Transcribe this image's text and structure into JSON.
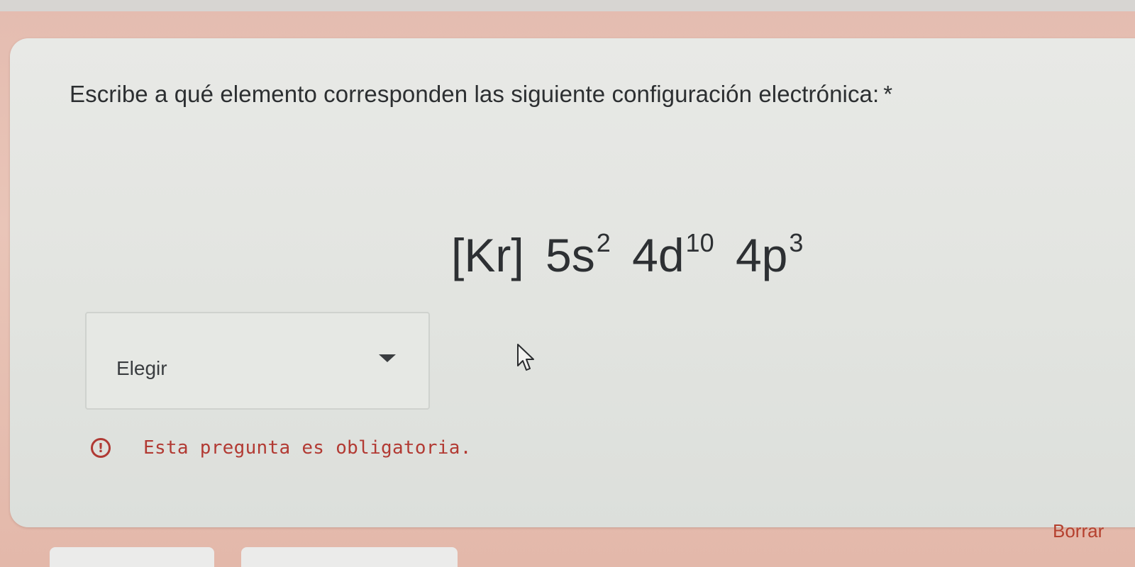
{
  "question": {
    "title": "Escribe a qué elemento corresponden las siguiente configuración electrónica:",
    "required_marker": "*"
  },
  "formula": {
    "core": "[Kr]",
    "terms": [
      {
        "base": "5s",
        "exponent": "2"
      },
      {
        "base": "4d",
        "exponent": "10"
      },
      {
        "base": "4p",
        "exponent": "3"
      }
    ]
  },
  "dropdown": {
    "selected": "Elegir",
    "arrow_icon": "caret-down-icon"
  },
  "validation": {
    "icon": "exclamation-circle-icon",
    "message": "Esta pregunta es obligatoria."
  },
  "footer": {
    "clear_label": "Borrar"
  },
  "colors": {
    "background": "#e6bfb2",
    "card": "#e4e6e2",
    "error": "#b03a34",
    "text": "#2c2f31"
  }
}
